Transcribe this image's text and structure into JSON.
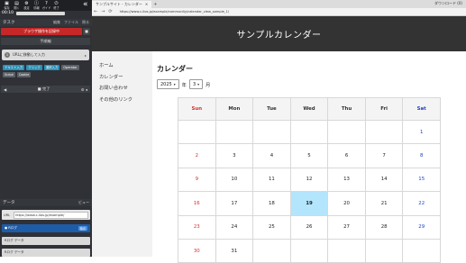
{
  "toolbar": {
    "items": [
      {
        "icon": "save-icon",
        "label": "保存"
      },
      {
        "icon": "folder-icon",
        "label": "開く"
      },
      {
        "icon": "gear-icon",
        "label": "設定"
      },
      {
        "icon": "info-icon",
        "label": "情報"
      },
      {
        "icon": "guide-icon",
        "label": "ガイド"
      },
      {
        "icon": "exit-icon",
        "label": "終了"
      }
    ],
    "collapse": "«"
  },
  "time": "00:10",
  "tasks": {
    "title": "タスク",
    "actions": [
      "編集",
      "ファイル",
      "閉る"
    ]
  },
  "run": {
    "label": "ブラウザ操作を記録中",
    "side": "■"
  },
  "section1": "手順編",
  "card": {
    "num": "1",
    "label": "URLに移動して入力",
    "arrow": "▸"
  },
  "chips": [
    "テキスト入力",
    "クリック",
    "選択入力",
    "Operator",
    "Script",
    "Cookie"
  ],
  "section2": {
    "left": "◀",
    "label": "■ 完了",
    "right": "⚙ ◂"
  },
  "data": {
    "title": "データ",
    "view": "ビュー"
  },
  "url_row": {
    "label": "URL",
    "value": "https://www.c-lios.jp/example/"
  },
  "rows": [
    {
      "label": "● Rログ",
      "tag": "抽出",
      "arrow": "▸"
    },
    {
      "label": "Rログ データ",
      "arrow": "▸"
    },
    {
      "label": "Rログ データ",
      "arrow": "▸"
    }
  ],
  "browser": {
    "tab": "サンプルサイト - カレンダー",
    "close": "×",
    "newtab": "+",
    "window": "ダウンロード (0)",
    "url": "https://www.c-lios.jp/example/community/calendar_view_sample_1/",
    "back": "←",
    "forward": "→",
    "reload": "⟳"
  },
  "site": {
    "title": "サンプルカレンダー",
    "nav": [
      "ホーム",
      "カレンダー",
      "お問い合わせ",
      "その他のリンク"
    ]
  },
  "calendar": {
    "heading": "カレンダー",
    "year": "2025",
    "year_unit": "年",
    "month": "3",
    "month_unit": "月",
    "days": [
      "Sun",
      "Mon",
      "Tue",
      "Wed",
      "Thu",
      "Fri",
      "Sat"
    ],
    "weeks": [
      [
        "",
        "",
        "",
        "",
        "",
        "",
        "1"
      ],
      [
        "2",
        "3",
        "4",
        "5",
        "6",
        "7",
        "8"
      ],
      [
        "9",
        "10",
        "11",
        "12",
        "13",
        "14",
        "15"
      ],
      [
        "16",
        "17",
        "18",
        "19",
        "20",
        "21",
        "22"
      ],
      [
        "23",
        "24",
        "25",
        "26",
        "27",
        "28",
        "29"
      ],
      [
        "30",
        "31",
        "",
        "",
        "",
        "",
        ""
      ]
    ],
    "today": "19",
    "colors": {
      "sun": "#d32f2f",
      "sat": "#1e40c8",
      "today_bg": "#b3e5fc"
    }
  }
}
